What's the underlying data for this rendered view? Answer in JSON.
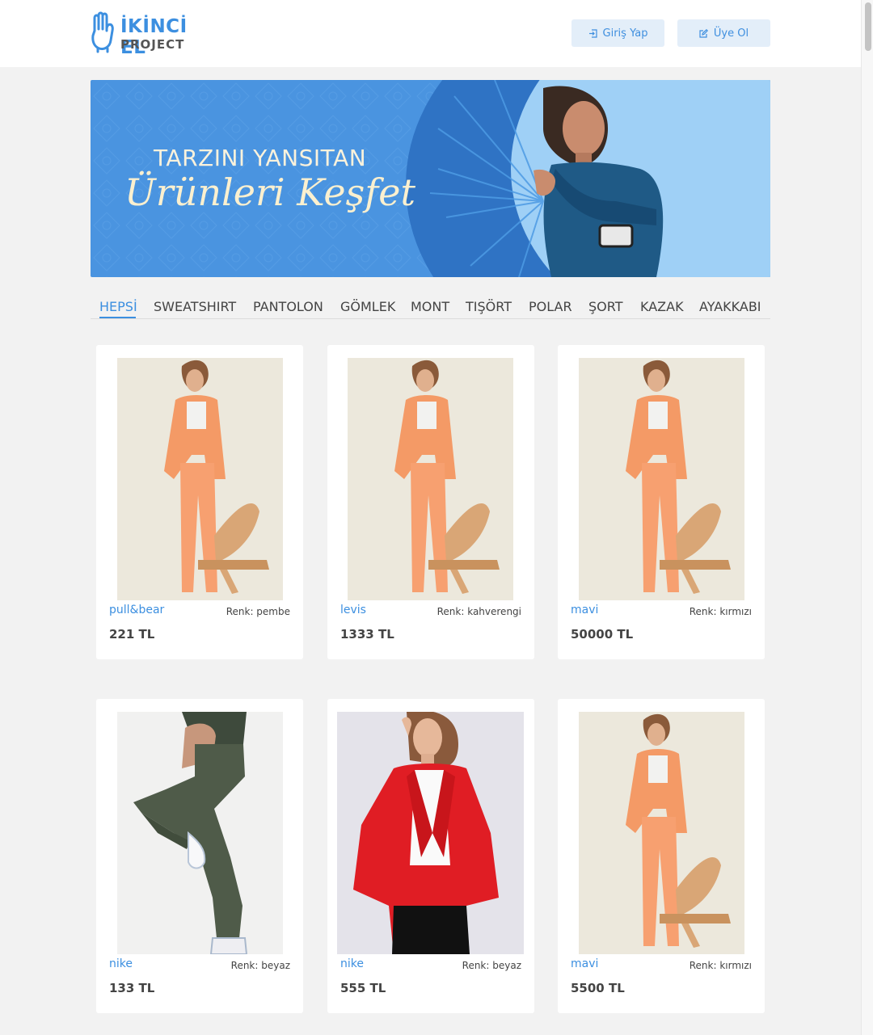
{
  "header": {
    "logo_title": "İKİNCİ EL",
    "logo_sub": "PROJECT",
    "login_label": "Giriş Yap",
    "signup_label": "Üye Ol"
  },
  "banner": {
    "line1": "TARZINI YANSITAN",
    "line2": "Ürünleri Keşfet"
  },
  "categories": [
    "HEPSİ",
    "SWEATSHIRT",
    "PANTOLON",
    "GÖMLEK",
    "MONT",
    "TIŞÖRT",
    "POLAR",
    "ŞORT",
    "KAZAK",
    "AYAKKABI"
  ],
  "active_category": "HEPSİ",
  "products": [
    {
      "brand": "pull&bear",
      "color": "Renk: pembe",
      "price": "221 TL",
      "image": "orange-suit-photo"
    },
    {
      "brand": "levis",
      "color": "Renk: kahverengi",
      "price": "1333 TL",
      "image": "orange-suit-photo"
    },
    {
      "brand": "mavi",
      "color": "Renk: kırmızı",
      "price": "50000 TL",
      "image": "orange-suit-photo"
    },
    {
      "brand": "nike",
      "color": "Renk: beyaz",
      "price": "133 TL",
      "image": "green-jogger-photo"
    },
    {
      "brand": "nike",
      "color": "Renk: beyaz",
      "price": "555 TL",
      "image": "red-blazer-photo"
    },
    {
      "brand": "mavi",
      "color": "Renk: kırmızı",
      "price": "5500 TL",
      "image": "orange-suit-photo"
    }
  ],
  "colors": {
    "accent": "#3c8fe0",
    "button_bg": "#e3eef9",
    "banner_bg": "#4a94e0",
    "page_bg": "#f2f2f2"
  }
}
